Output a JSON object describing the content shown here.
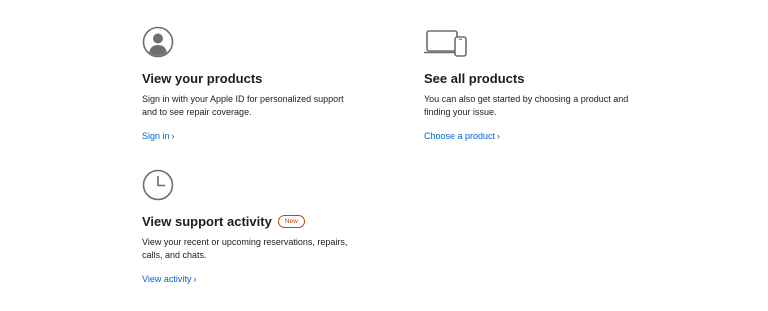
{
  "cards": [
    {
      "icon": "person-circle-icon",
      "title": "View your products",
      "description": "Sign in with your Apple ID for personalized support and to see repair coverage.",
      "link_label": "Sign in",
      "link_chevron": "›"
    },
    {
      "icon": "laptop-phone-icon",
      "title": "See all products",
      "description": "You can also get started by choosing a product and finding your issue.",
      "link_label": "Choose a product",
      "link_chevron": "›"
    },
    {
      "icon": "clock-icon",
      "title": "View support activity",
      "badge": "New",
      "description": "View your recent or upcoming reservations, repairs, calls, and chats.",
      "link_label": "View activity",
      "link_chevron": "›"
    }
  ],
  "colors": {
    "text": "#1d1d1f",
    "link": "#0066cc",
    "icon": "#6e6e73",
    "badge": "#bf4800"
  }
}
